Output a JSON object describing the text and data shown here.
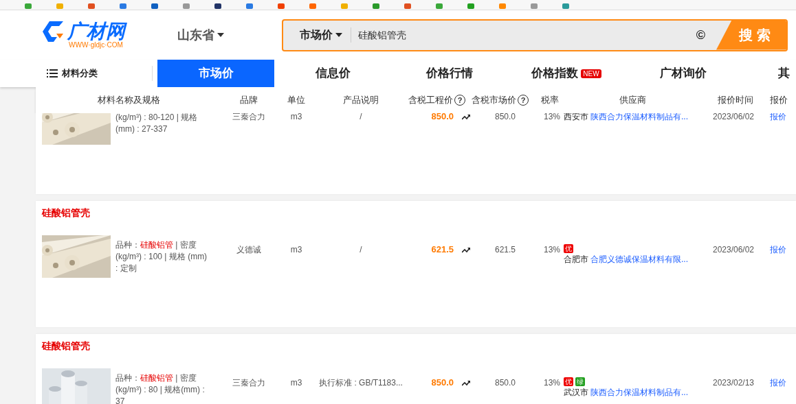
{
  "logo": {
    "name": "广材网",
    "url": "WWW·gldjc·COM"
  },
  "region": {
    "label": "山东省"
  },
  "search": {
    "scope": "市场价",
    "value": "硅酸铝管壳",
    "icon": "©",
    "button": "搜 索"
  },
  "nav": {
    "category": "材料分类",
    "tabs": [
      {
        "label": "市场价",
        "selected": true
      },
      {
        "label": "信息价",
        "selected": false
      },
      {
        "label": "价格行情",
        "selected": false
      },
      {
        "label": "价格指数",
        "selected": false,
        "badge": "NEW"
      },
      {
        "label": "广材询价",
        "selected": false
      },
      {
        "label": "其",
        "selected": false
      }
    ]
  },
  "table": {
    "columns": [
      {
        "label": "材料名称及规格"
      },
      {
        "label": "品牌"
      },
      {
        "label": "单位"
      },
      {
        "label": "产品说明"
      },
      {
        "label": "含税工程价",
        "help": "?"
      },
      {
        "label": "含税市场价",
        "help": "?"
      },
      {
        "label": "税率"
      },
      {
        "label": "供应商"
      },
      {
        "label": "报价时间"
      },
      {
        "label": "报价"
      }
    ],
    "rows": [
      {
        "spec": "(kg/m³) : 80-120 | 规格 (mm) : 27-337",
        "brand": "三秦合力",
        "unit": "m3",
        "description": "/",
        "project_price": "850.0",
        "market_price": "850.0",
        "tax_rate": "13%",
        "city": "西安市",
        "supplier": "陕西合力保温材料制品有...",
        "date": "2023/06/02",
        "action": "报价"
      },
      {
        "title": "硅酸铝管壳",
        "spec_prefix": "品种：",
        "variety": "硅酸铝管",
        "spec": " | 密度 (kg/m³) : 100 | 规格 (mm) : 定制",
        "brand": "义德诚",
        "unit": "m3",
        "description": "/",
        "project_price": "621.5",
        "market_price": "621.5",
        "tax_rate": "13%",
        "badges": [
          {
            "label": "优",
            "color": "#ee0000"
          }
        ],
        "city": "合肥市",
        "supplier": "合肥义德诚保温材料有限...",
        "date": "2023/06/02",
        "action": "报价"
      },
      {
        "title": "硅酸铝管壳",
        "spec_prefix": "品种：",
        "variety": "硅酸铝管",
        "spec": " | 密度 (kg/m³) : 80 | 规格(mm) : 37",
        "brand": "三秦合力",
        "unit": "m3",
        "description": "执行标准 : GB/T1183...",
        "project_price": "850.0",
        "market_price": "850.0",
        "tax_rate": "13%",
        "badges": [
          {
            "label": "优",
            "color": "#ee0000"
          },
          {
            "label": "绿",
            "color": "#22a020"
          }
        ],
        "city": "武汉市",
        "supplier": "陕西合力保温材料制品有...",
        "date": "2023/02/13",
        "action": "报价"
      }
    ]
  }
}
